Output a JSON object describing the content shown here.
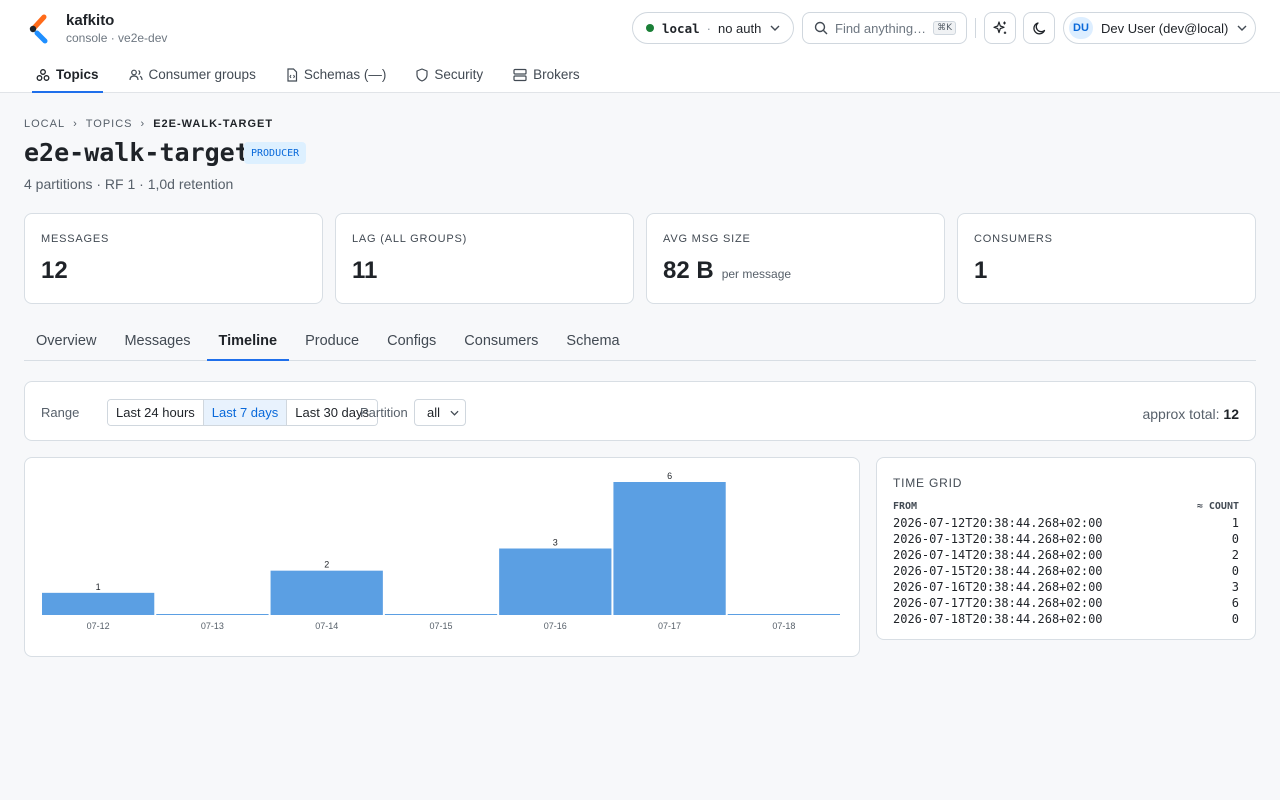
{
  "app": {
    "name": "kafkito",
    "subtitle": "console · ve2e-dev"
  },
  "header": {
    "env_name": "local",
    "env_separator": "·",
    "env_auth": "no auth",
    "search_placeholder": "Find anything…",
    "search_shortcut": "⌘K",
    "user_initials": "DU",
    "user_name": "Dev User (dev@local)"
  },
  "nav": [
    {
      "label": "Topics",
      "icon": "topics-icon",
      "active": true
    },
    {
      "label": "Consumer groups",
      "icon": "users-icon",
      "active": false
    },
    {
      "label": "Schemas (—)",
      "icon": "file-code-icon",
      "active": false
    },
    {
      "label": "Security",
      "icon": "shield-icon",
      "active": false
    },
    {
      "label": "Brokers",
      "icon": "server-icon",
      "active": false
    }
  ],
  "breadcrumb": [
    "LOCAL",
    "›",
    "TOPICS",
    "›",
    "E2E-WALK-TARGET"
  ],
  "topic": {
    "title": "e2e-walk-target",
    "badge": "PRODUCER",
    "subtitle": "4 partitions · RF 1 · 1,0d retention"
  },
  "stats": [
    {
      "label": "MESSAGES",
      "value": "12",
      "unit": ""
    },
    {
      "label": "LAG (ALL GROUPS)",
      "value": "11",
      "unit": ""
    },
    {
      "label": "AVG MSG SIZE",
      "value": "82 B",
      "unit": "per message"
    },
    {
      "label": "CONSUMERS",
      "value": "1",
      "unit": ""
    }
  ],
  "tabs": [
    {
      "label": "Overview",
      "active": false
    },
    {
      "label": "Messages",
      "active": false
    },
    {
      "label": "Timeline",
      "active": true
    },
    {
      "label": "Produce",
      "active": false
    },
    {
      "label": "Configs",
      "active": false
    },
    {
      "label": "Consumers",
      "active": false
    },
    {
      "label": "Schema",
      "active": false
    }
  ],
  "filter": {
    "range_label": "Range",
    "ranges": [
      {
        "label": "Last 24 hours",
        "active": false
      },
      {
        "label": "Last 7 days",
        "active": true
      },
      {
        "label": "Last 30 days",
        "active": false
      }
    ],
    "partition_label": "Partition",
    "partition_value": "all",
    "total_label": "approx total:",
    "total_value": "12"
  },
  "chart_data": {
    "type": "bar",
    "categories": [
      "07-12",
      "07-13",
      "07-14",
      "07-15",
      "07-16",
      "07-17",
      "07-18"
    ],
    "values": [
      1,
      0,
      2,
      0,
      3,
      6,
      0
    ],
    "title": "",
    "xlabel": "",
    "ylabel": "",
    "ylim": [
      0,
      6
    ],
    "grid": false,
    "bar_color": "#5b9fe3"
  },
  "time_grid": {
    "title": "TIME GRID",
    "col_from": "FROM",
    "col_count": "≈ COUNT",
    "rows": [
      {
        "from": "2026-07-12T20:38:44.268+02:00",
        "count": "1"
      },
      {
        "from": "2026-07-13T20:38:44.268+02:00",
        "count": "0"
      },
      {
        "from": "2026-07-14T20:38:44.268+02:00",
        "count": "2"
      },
      {
        "from": "2026-07-15T20:38:44.268+02:00",
        "count": "0"
      },
      {
        "from": "2026-07-16T20:38:44.268+02:00",
        "count": "3"
      },
      {
        "from": "2026-07-17T20:38:44.268+02:00",
        "count": "6"
      },
      {
        "from": "2026-07-18T20:38:44.268+02:00",
        "count": "0"
      }
    ]
  },
  "colors": {
    "accent": "#1f6feb",
    "status_ok": "#1a7f37",
    "badge_bg": "#ddf0ff"
  }
}
